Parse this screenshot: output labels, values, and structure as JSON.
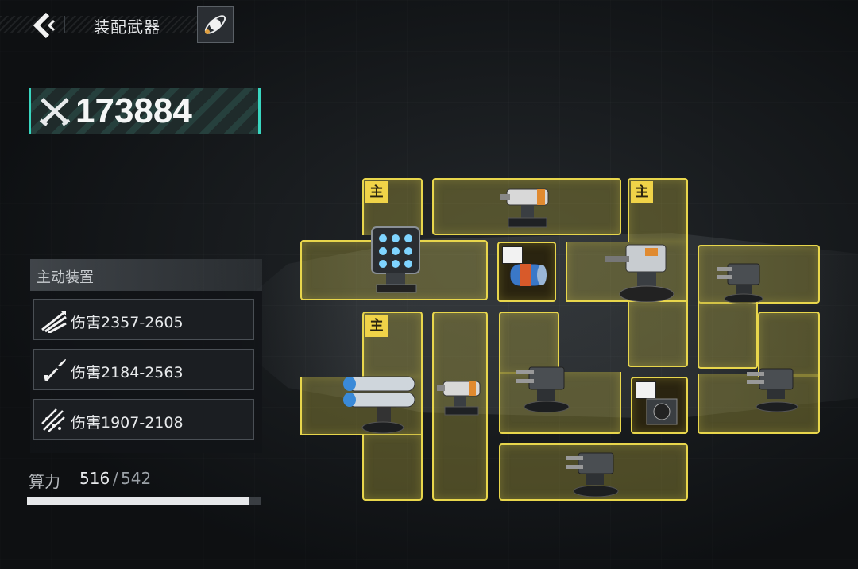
{
  "header": {
    "title": "装配武器",
    "back_icon": "chevron-left-icon",
    "tool_icon": "satellite-icon"
  },
  "power": {
    "value": "173884",
    "icon": "crossed-swords-icon"
  },
  "active_equipment": {
    "title": "主动装置",
    "items": [
      {
        "icon": "triple-missile-icon",
        "label": "伤害2357-2605"
      },
      {
        "icon": "rocket-icon",
        "label": "伤害2184-2563"
      },
      {
        "icon": "scatter-missile-icon",
        "label": "伤害1907-2108"
      }
    ]
  },
  "compute": {
    "label": "算力",
    "used": "516",
    "separator": "/",
    "total": "542",
    "progress": 0.952
  },
  "slots": {
    "main_badge": "主",
    "chip_icon": "ammo-chip-icon"
  },
  "colors": {
    "slot_border": "#e8d64c",
    "accent": "#39d6c0",
    "badge": "#f0d348"
  }
}
